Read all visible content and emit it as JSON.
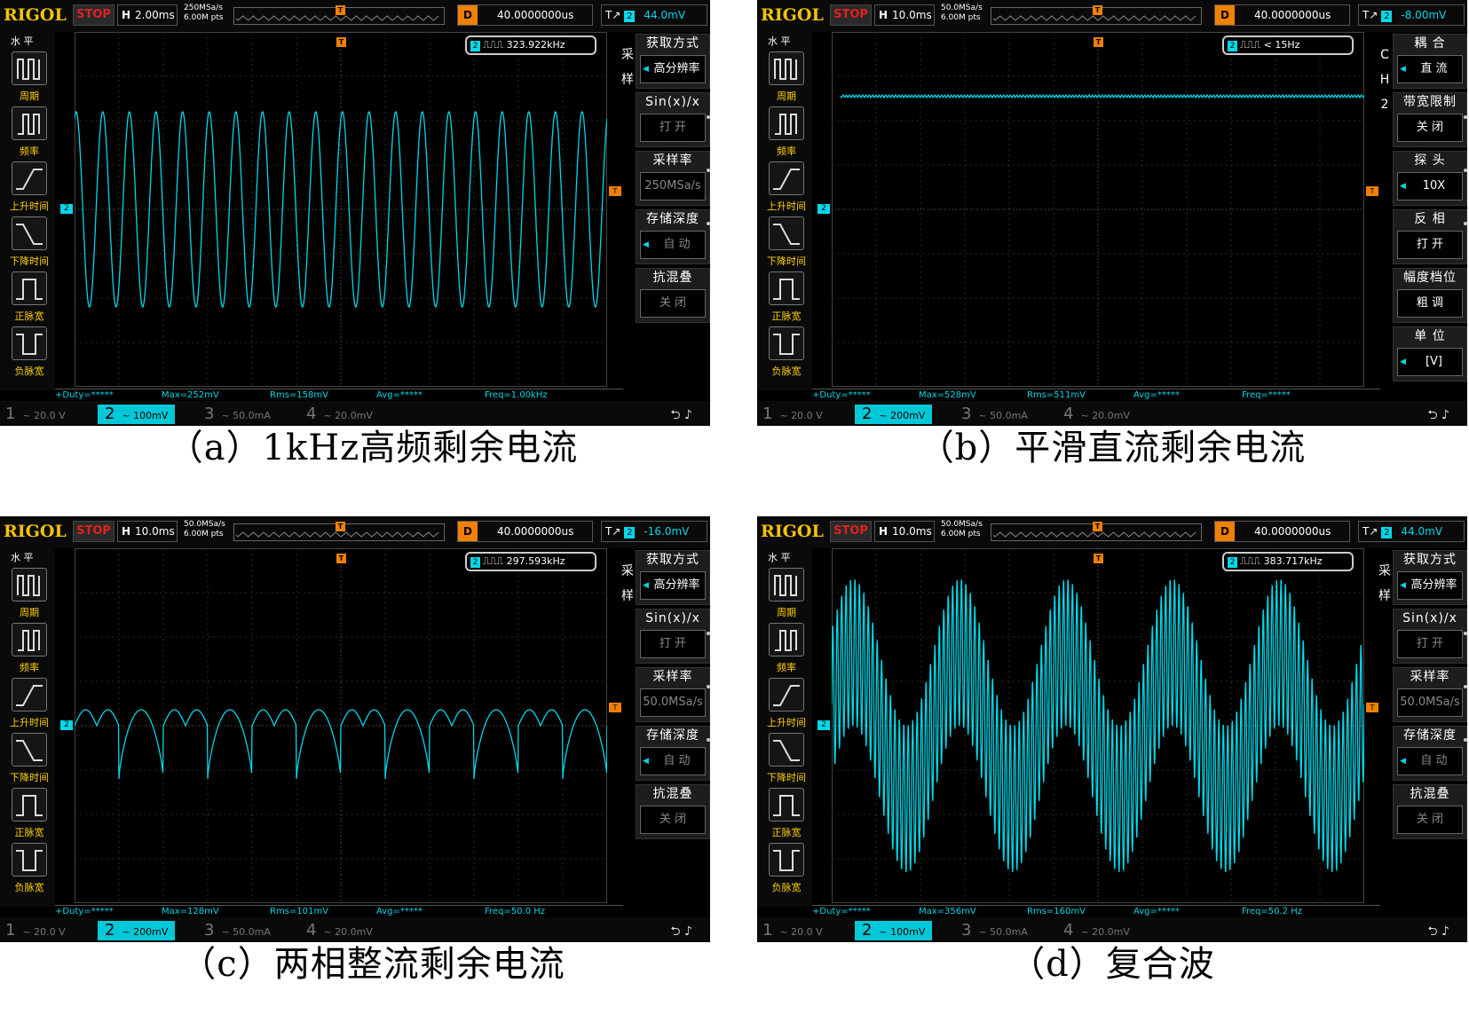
{
  "shared": {
    "brand": "RIGOL",
    "state": "STOP",
    "h_label": "H",
    "d_label": "D",
    "t_label": "T",
    "delay": "40.0000000us",
    "left_menu_title": "水 平",
    "left_menu": [
      "周期",
      "频率",
      "上升时间",
      "下降时间",
      "正脉宽",
      "负脉宽"
    ],
    "ch1": {
      "num": "1",
      "val": "20.0 V"
    },
    "ch3": {
      "num": "3",
      "val": "50.0mA"
    },
    "ch4": {
      "num": "4",
      "val": "20.0mV"
    },
    "ch2_num": "2",
    "duty": "+Duty=*****",
    "avg": "Avg=*****",
    "colors": {
      "trace": "#00d8e8",
      "trigger": "#f08000",
      "brand": "#f2c400",
      "stop": "#e02020"
    }
  },
  "panels": [
    {
      "id": "a",
      "timebase": "2.00ms",
      "srate": "250MSa/s",
      "pts": "6.00M pts",
      "trig_level": "44.0mV",
      "freq": "323.922kHz",
      "ch2_scale": "100mV",
      "max": "Max=252mV",
      "rms": "Rms=158mV",
      "freqm": "Freq=1.00kHz",
      "side": [
        "采",
        "样"
      ],
      "menu": [
        {
          "head": "获取方式",
          "val": "高分辨率",
          "arrow": true,
          "dim": false
        },
        {
          "head": "Sin(x)/x",
          "val": "打 开",
          "arrow": false,
          "dim": true
        },
        {
          "head": "采样率",
          "val": "250MSa/s",
          "arrow": false,
          "dim": true
        },
        {
          "head": "存储深度",
          "val": "自 动",
          "arrow": true,
          "dim": true
        },
        {
          "head": "抗混叠",
          "val": "关 闭",
          "arrow": false,
          "dim": true
        }
      ],
      "caption": "（a）1kHz高频剩余电流",
      "wave": {
        "kind": "sine",
        "cycles": 20,
        "amplitude_mv": 110,
        "offset_mv": 0
      }
    },
    {
      "id": "b",
      "timebase": "10.0ms",
      "srate": "50.0MSa/s",
      "pts": "6.00M pts",
      "trig_level": "-8.00mV",
      "freq": "< 15Hz",
      "ch2_scale": "200mV",
      "max": "Max=528mV",
      "rms": "Rms=511mV",
      "freqm": "Freq=*****",
      "side": [
        "C",
        "H",
        "2"
      ],
      "menu": [
        {
          "head": "耦 合",
          "val": "直 流",
          "arrow": true,
          "dim": false
        },
        {
          "head": "带宽限制",
          "val": "关 闭",
          "arrow": false,
          "dim": false
        },
        {
          "head": "探 头",
          "val": "10X",
          "arrow": true,
          "dim": false
        },
        {
          "head": "反 相",
          "val": "打 开",
          "arrow": false,
          "dim": false
        },
        {
          "head": "幅度档位",
          "val": "粗 调",
          "arrow": false,
          "dim": false
        },
        {
          "head": "单 位",
          "val": "[V]",
          "arrow": true,
          "dim": false
        }
      ],
      "caption": "（b）平滑直流剩余电流",
      "wave": {
        "kind": "dc",
        "level_mv": 510
      }
    },
    {
      "id": "c",
      "timebase": "10.0ms",
      "srate": "50.0MSa/s",
      "pts": "6.00M pts",
      "trig_level": "-16.0mV",
      "freq": "297.593kHz",
      "ch2_scale": "200mV",
      "max": "Max=128mV",
      "rms": "Rms=101mV",
      "freqm": "Freq=50.0 Hz",
      "side": [
        "采",
        "样"
      ],
      "menu": [
        {
          "head": "获取方式",
          "val": "高分辨率",
          "arrow": true,
          "dim": false
        },
        {
          "head": "Sin(x)/x",
          "val": "打 开",
          "arrow": false,
          "dim": true
        },
        {
          "head": "采样率",
          "val": "50.0MSa/s",
          "arrow": false,
          "dim": true
        },
        {
          "head": "存储深度",
          "val": "自 动",
          "arrow": true,
          "dim": true
        },
        {
          "head": "抗混叠",
          "val": "关 闭",
          "arrow": false,
          "dim": true
        }
      ],
      "caption": "（c）两相整流剩余电流",
      "wave": {
        "kind": "rect2",
        "cycles": 6,
        "peak_mv": 40,
        "dip_mv": -240
      }
    },
    {
      "id": "d",
      "timebase": "10.0ms",
      "srate": "50.0MSa/s",
      "pts": "6.00M pts",
      "trig_level": "44.0mV",
      "freq": "383.717kHz",
      "ch2_scale": "100mV",
      "max": "Max=356mV",
      "rms": "Rms=160mV",
      "freqm": "Freq=50.2 Hz",
      "side": [
        "采",
        "样"
      ],
      "menu": [
        {
          "head": "获取方式",
          "val": "高分辨率",
          "arrow": true,
          "dim": false
        },
        {
          "head": "Sin(x)/x",
          "val": "打 开",
          "arrow": false,
          "dim": true
        },
        {
          "head": "采样率",
          "val": "50.0MSa/s",
          "arrow": false,
          "dim": true
        },
        {
          "head": "存储深度",
          "val": "自 动",
          "arrow": true,
          "dim": true
        },
        {
          "head": "抗混叠",
          "val": "关 闭",
          "arrow": false,
          "dim": true
        }
      ],
      "caption": "（d）复合波",
      "wave": {
        "kind": "composite",
        "cycles": 5,
        "hf_cycles": 120,
        "amplitude_mv": 300
      }
    }
  ]
}
